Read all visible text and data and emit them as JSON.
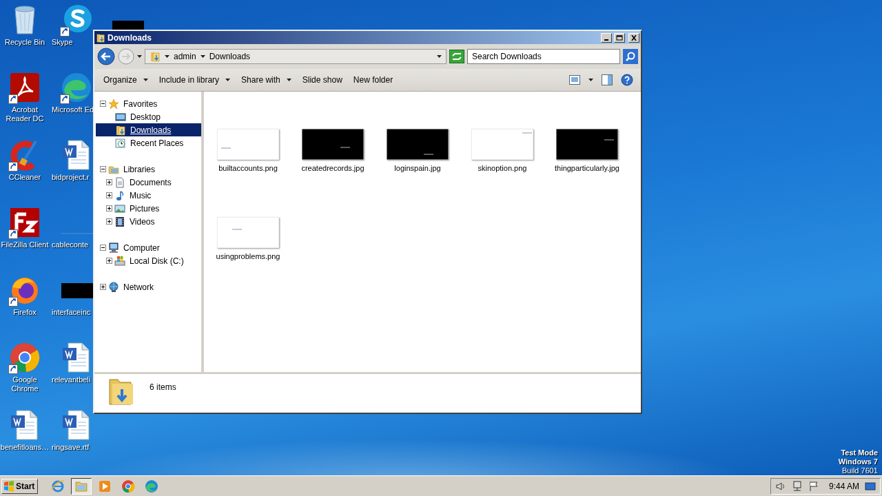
{
  "desktop_icons": [
    {
      "label": "Recycle Bin",
      "kind": "recycle",
      "shortcut": false
    },
    {
      "label": "Skype",
      "kind": "skype",
      "shortcut": true
    },
    {
      "label": "Acrobat Reader DC",
      "kind": "acrobat",
      "shortcut": true
    },
    {
      "label": "Microsoft Ed",
      "kind": "edge",
      "shortcut": true
    },
    {
      "label": "CCleaner",
      "kind": "ccleaner",
      "shortcut": true
    },
    {
      "label": "bidproject.r",
      "kind": "word",
      "shortcut": false
    },
    {
      "label": "FileZilla Client",
      "kind": "filezilla",
      "shortcut": true
    },
    {
      "label": "cableconte",
      "kind": "blank",
      "shortcut": false
    },
    {
      "label": "Firefox",
      "kind": "firefox",
      "shortcut": true
    },
    {
      "label": "interfaceinc",
      "kind": "black",
      "shortcut": false
    },
    {
      "label": "Google Chrome",
      "kind": "chrome",
      "shortcut": true
    },
    {
      "label": "relevantbeli",
      "kind": "word",
      "shortcut": false
    },
    {
      "label": "benefitloans…",
      "kind": "word",
      "shortcut": false
    },
    {
      "label": "ringsave.rtf",
      "kind": "word",
      "shortcut": false
    }
  ],
  "partial_icon": {
    "kind": "black"
  },
  "desktop_notice": [
    {
      "text": "Test Mode",
      "bold": true
    },
    {
      "text": "Windows 7",
      "bold": true
    },
    {
      "text": "Build 7601",
      "bold": false
    }
  ],
  "window": {
    "title": "Downloads",
    "breadcrumb": [
      "admin",
      "Downloads"
    ],
    "search": {
      "placeholder": "Search Downloads"
    },
    "toolbar": [
      {
        "label": "Organize",
        "dropdown": true
      },
      {
        "label": "Include in library",
        "dropdown": true
      },
      {
        "label": "Share with",
        "dropdown": true
      },
      {
        "label": "Slide show",
        "dropdown": false
      },
      {
        "label": "New folder",
        "dropdown": false
      }
    ],
    "nav": [
      {
        "label": "Favorites",
        "kind": "star",
        "expanded": true,
        "selected": false,
        "children": [
          {
            "label": "Desktop",
            "kind": "desktop",
            "selected": false
          },
          {
            "label": "Downloads",
            "kind": "downloads",
            "selected": true
          },
          {
            "label": "Recent Places",
            "kind": "recent",
            "selected": false
          }
        ]
      },
      {
        "label": "Libraries",
        "kind": "libraries",
        "expanded": true,
        "selected": false,
        "children": [
          {
            "label": "Documents",
            "kind": "documents",
            "expanded": false,
            "selected": false
          },
          {
            "label": "Music",
            "kind": "music",
            "expanded": false,
            "selected": false
          },
          {
            "label": "Pictures",
            "kind": "pictures",
            "expanded": false,
            "selected": false
          },
          {
            "label": "Videos",
            "kind": "videos",
            "expanded": false,
            "selected": false
          }
        ]
      },
      {
        "label": "Computer",
        "kind": "computer",
        "expanded": true,
        "selected": false,
        "children": [
          {
            "label": "Local Disk (C:)",
            "kind": "disk",
            "expanded": false,
            "selected": false
          }
        ]
      },
      {
        "label": "Network",
        "kind": "network",
        "expanded": false,
        "selected": false
      }
    ],
    "files": [
      {
        "name": "builtaccounts.png",
        "kind": "light_thumbnail"
      },
      {
        "name": "createdrecords.jpg",
        "kind": "dark_thumbnail"
      },
      {
        "name": "loginspain.jpg",
        "kind": "dark_thumbnail"
      },
      {
        "name": "skinoption.png",
        "kind": "light_thumbnail"
      },
      {
        "name": "thingparticularly.jpg",
        "kind": "dark_thumbnail"
      },
      {
        "name": "usingproblems.png",
        "kind": "light_thumbnail"
      }
    ],
    "details": {
      "count": "6 items"
    }
  },
  "taskbar": {
    "start": "Start",
    "apps": [
      {
        "kind": "ie",
        "selected": false
      },
      {
        "kind": "explorer",
        "selected": true
      },
      {
        "kind": "media",
        "selected": false
      },
      {
        "kind": "chrome",
        "selected": false
      },
      {
        "kind": "edge",
        "selected": false
      }
    ],
    "clock": "9:44 AM"
  }
}
